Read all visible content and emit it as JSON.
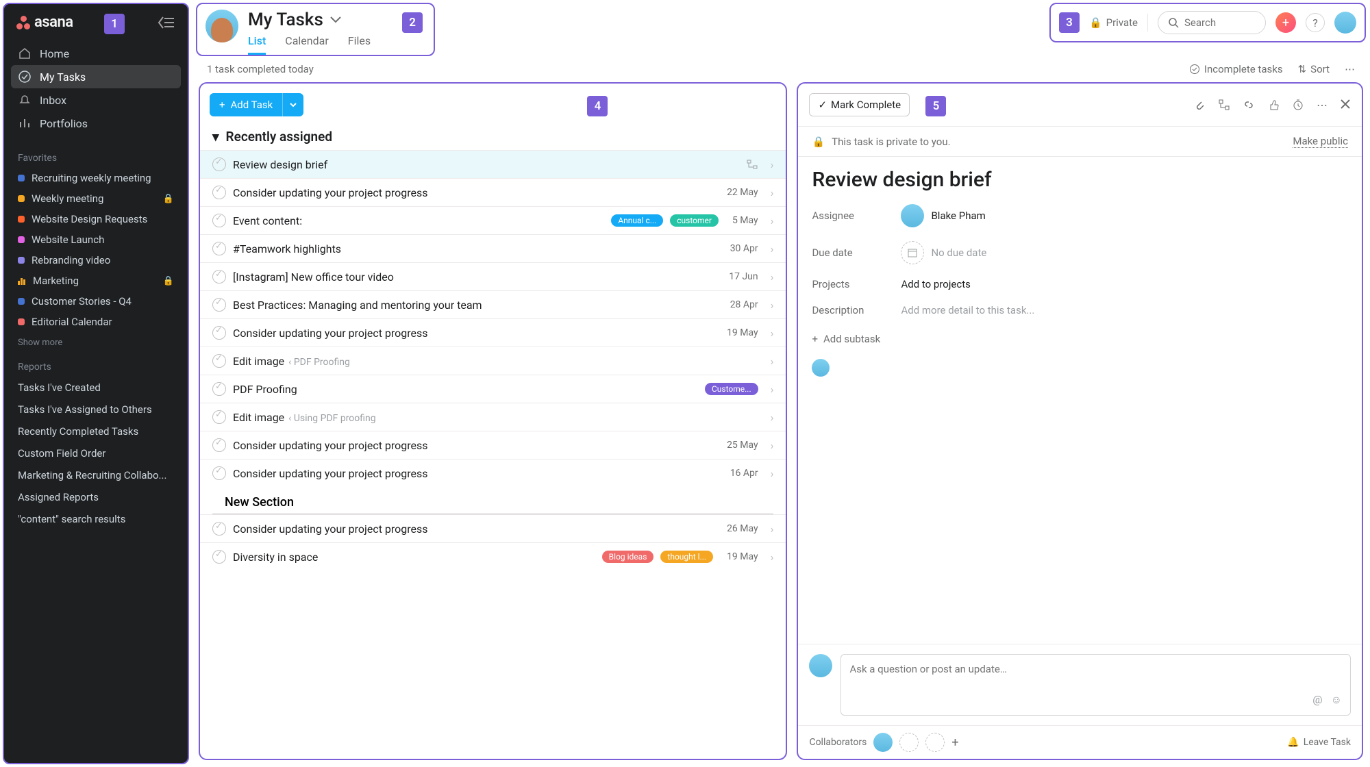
{
  "app_name": "asana",
  "sidebar": {
    "nav": [
      {
        "label": "Home",
        "icon": "home-icon"
      },
      {
        "label": "My Tasks",
        "icon": "check-icon",
        "active": true
      },
      {
        "label": "Inbox",
        "icon": "bell-icon"
      },
      {
        "label": "Portfolios",
        "icon": "bars-icon"
      }
    ],
    "favorites_label": "Favorites",
    "favorites": [
      {
        "label": "Recruiting weekly meeting",
        "color": "#4573d2"
      },
      {
        "label": "Weekly meeting",
        "color": "#f5a623",
        "locked": true
      },
      {
        "label": "Website Design Requests",
        "color": "#fd612c"
      },
      {
        "label": "Website Launch",
        "color": "#e362e3"
      },
      {
        "label": "Rebranding video",
        "color": "#8d84e8"
      },
      {
        "label": "Marketing",
        "bars": true,
        "locked": true
      },
      {
        "label": "Customer Stories - Q4",
        "color": "#4573d2"
      },
      {
        "label": "Editorial Calendar",
        "color": "#f06a6a"
      }
    ],
    "show_more": "Show more",
    "reports_label": "Reports",
    "reports": [
      "Tasks I've Created",
      "Tasks I've Assigned to Others",
      "Recently Completed Tasks",
      "Custom Field Order",
      "Marketing & Recruiting Collabo...",
      "Assigned Reports",
      "\"content\" search results"
    ]
  },
  "header": {
    "title": "My Tasks",
    "tabs": [
      {
        "label": "List",
        "active": true
      },
      {
        "label": "Calendar"
      },
      {
        "label": "Files"
      }
    ]
  },
  "top_right": {
    "private_label": "Private",
    "search_placeholder": "Search"
  },
  "toolbar": {
    "completed_text": "1 task completed today",
    "filter": "Incomplete tasks",
    "sort": "Sort"
  },
  "task_pane": {
    "add_task": "Add Task",
    "sections": [
      {
        "name": "Recently assigned",
        "collapsible": true,
        "tasks": [
          {
            "name": "Review design brief",
            "selected": true,
            "icon": "subtask"
          },
          {
            "name": "Consider updating your project progress",
            "date": "22 May"
          },
          {
            "name": "Event content:",
            "tags": [
              {
                "text": "Annual c...",
                "color": "#14aaf5"
              },
              {
                "text": "customer",
                "color": "#25c4a6"
              }
            ],
            "date": "5 May"
          },
          {
            "name": "#Teamwork highlights",
            "date": "30 Apr"
          },
          {
            "name": "[Instagram] New office tour video",
            "date": "17 Jun"
          },
          {
            "name": "Best Practices: Managing and mentoring your team",
            "date": "28 Apr"
          },
          {
            "name": "Consider updating your project progress",
            "date": "19 May"
          },
          {
            "name": "Edit image",
            "context": "‹ PDF Proofing"
          },
          {
            "name": "PDF Proofing",
            "tags": [
              {
                "text": "Custome...",
                "color": "#7b5fd9"
              }
            ]
          },
          {
            "name": "Edit image",
            "context": "‹ Using PDF proofing"
          },
          {
            "name": "Consider updating your project progress",
            "date": "25 May"
          },
          {
            "name": "Consider updating your project progress",
            "date": "16 Apr"
          }
        ]
      },
      {
        "name": "New Section",
        "collapsible": false,
        "tasks": [
          {
            "name": "Consider updating your project progress",
            "date": "26 May"
          },
          {
            "name": "Diversity in space",
            "tags": [
              {
                "text": "Blog ideas",
                "color": "#f06a6a"
              },
              {
                "text": "thought l...",
                "color": "#f5a623"
              }
            ],
            "date": "19 May"
          }
        ]
      }
    ]
  },
  "detail": {
    "mark_complete": "Mark Complete",
    "privacy_text": "This task is private to you.",
    "make_public": "Make public",
    "title": "Review design brief",
    "assignee_label": "Assignee",
    "assignee_value": "Blake Pham",
    "due_label": "Due date",
    "due_value": "No due date",
    "projects_label": "Projects",
    "projects_value": "Add to projects",
    "description_label": "Description",
    "description_placeholder": "Add more detail to this task...",
    "add_subtask": "Add subtask",
    "comment_placeholder": "Ask a question or post an update…",
    "collaborators_label": "Collaborators",
    "leave_task": "Leave Task"
  },
  "callouts": {
    "c1": "1",
    "c2": "2",
    "c3": "3",
    "c4": "4",
    "c5": "5"
  }
}
